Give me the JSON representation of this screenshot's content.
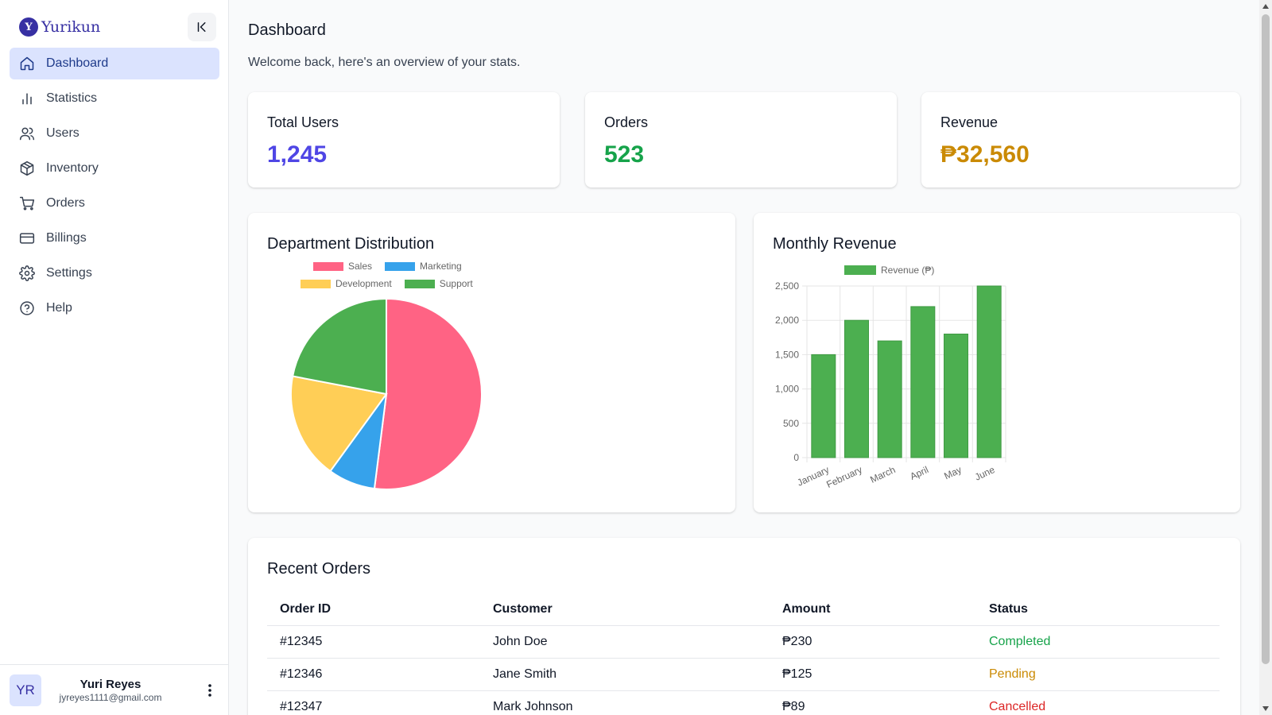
{
  "brand": {
    "badge": "Y",
    "name": "Yurikun"
  },
  "sidebar": {
    "items": [
      {
        "label": "Dashboard",
        "icon": "home-icon",
        "active": true
      },
      {
        "label": "Statistics",
        "icon": "bar-chart-icon"
      },
      {
        "label": "Users",
        "icon": "users-icon"
      },
      {
        "label": "Inventory",
        "icon": "package-icon"
      },
      {
        "label": "Orders",
        "icon": "cart-icon"
      },
      {
        "label": "Billings",
        "icon": "credit-card-icon"
      },
      {
        "label": "Settings",
        "icon": "gear-icon"
      },
      {
        "label": "Help",
        "icon": "help-circle-icon"
      }
    ]
  },
  "profile": {
    "initials": "YR",
    "name": "Yuri Reyes",
    "email": "jyreyes1111@gmail.com"
  },
  "header": {
    "title": "Dashboard",
    "subtitle": "Welcome back, here's an overview of your stats."
  },
  "stats": [
    {
      "label": "Total Users",
      "value": "1,245",
      "color": "#4f46e5"
    },
    {
      "label": "Orders",
      "value": "523",
      "color": "#16a34a"
    },
    {
      "label": "Revenue",
      "value": "₱32,560",
      "color": "#ca8a04"
    }
  ],
  "department_chart": {
    "title": "Department Distribution"
  },
  "revenue_chart": {
    "title": "Monthly Revenue"
  },
  "chart_data": [
    {
      "type": "pie",
      "title": "Department Distribution",
      "legend_position": "top",
      "categories": [
        "Sales",
        "Marketing",
        "Development",
        "Support"
      ],
      "values": [
        52,
        8,
        18,
        22
      ],
      "colors": [
        "#ff6384",
        "#36a2eb",
        "#ffce56",
        "#4caf50"
      ]
    },
    {
      "type": "bar",
      "title": "Monthly Revenue",
      "legend_position": "top",
      "categories": [
        "January",
        "February",
        "March",
        "April",
        "May",
        "June"
      ],
      "series": [
        {
          "name": "Revenue (₱)",
          "values": [
            1500,
            2000,
            1700,
            2200,
            1800,
            2500
          ],
          "color": "#4caf50"
        }
      ],
      "y_ticks": [
        "0",
        "500",
        "1,000",
        "1,500",
        "2,000",
        "2,500"
      ],
      "ylim": [
        0,
        2500
      ],
      "grid": true
    }
  ],
  "orders": {
    "title": "Recent Orders",
    "headers": [
      "Order ID",
      "Customer",
      "Amount",
      "Status"
    ],
    "rows": [
      {
        "id": "#12345",
        "customer": "John Doe",
        "amount": "₱230",
        "status": "Completed",
        "status_color": "#16a34a"
      },
      {
        "id": "#12346",
        "customer": "Jane Smith",
        "amount": "₱125",
        "status": "Pending",
        "status_color": "#ca8a04"
      },
      {
        "id": "#12347",
        "customer": "Mark Johnson",
        "amount": "₱89",
        "status": "Cancelled",
        "status_color": "#dc2626"
      }
    ]
  }
}
